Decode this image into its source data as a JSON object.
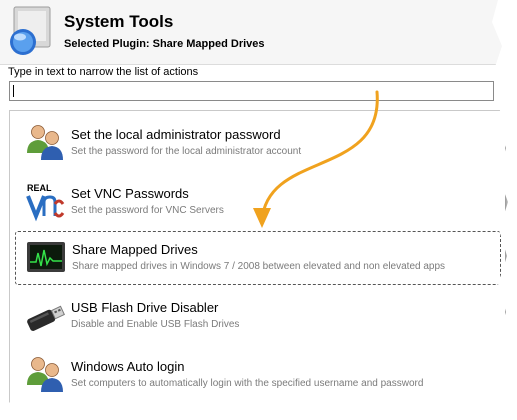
{
  "header": {
    "title": "System Tools",
    "subtitle": "Selected Plugin: Share Mapped Drives"
  },
  "filter": {
    "label": "Type in text to narrow the list of actions",
    "value": ""
  },
  "actions": [
    {
      "title": "Set the local administrator password",
      "description": "Set the password for the local administrator account",
      "icon": "users-icon"
    },
    {
      "title": "Set VNC Passwords",
      "description": "Set the password for VNC Servers",
      "icon": "realvnc-logo-icon",
      "logo_text": "REAL"
    },
    {
      "title": "Share Mapped Drives",
      "description": "Share mapped drives in Windows 7 / 2008 between elevated and non elevated apps",
      "icon": "monitor-activity-icon",
      "selected": true
    },
    {
      "title": "USB Flash Drive Disabler",
      "description": "Disable and Enable USB Flash Drives",
      "icon": "usb-drive-icon"
    },
    {
      "title": "Windows Auto login",
      "description": "Set computers to automatically login with the specified username and password",
      "icon": "users-icon"
    }
  ],
  "colors": {
    "arrow": "#f0a21e",
    "header_bg": "#f6f6f6",
    "description_text": "#7b7b7b",
    "vnc_logo": "#2a6ec2"
  }
}
